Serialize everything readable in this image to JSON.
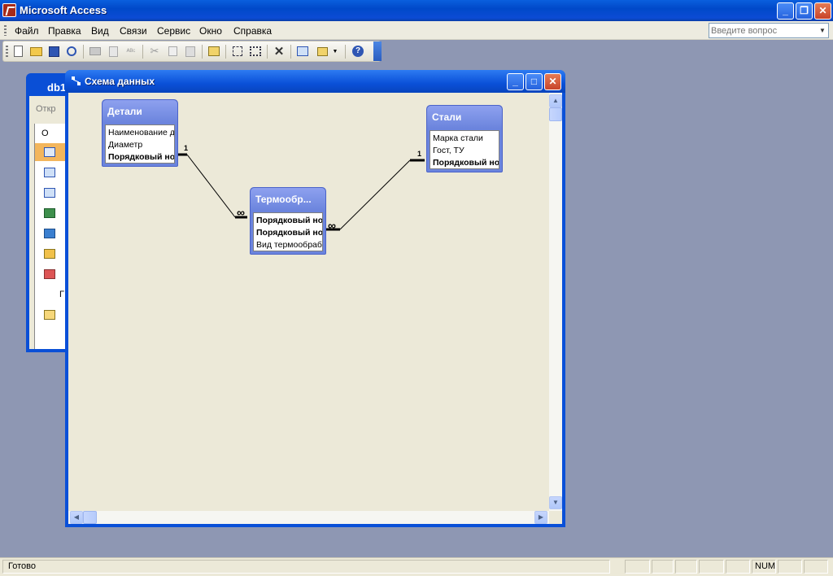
{
  "app": {
    "title": "Microsoft Access"
  },
  "menu": {
    "items": [
      "Файл",
      "Правка",
      "Вид",
      "Связи",
      "Сервис",
      "Окно",
      "Справка"
    ],
    "help_placeholder": "Введите вопрос"
  },
  "db_window": {
    "title": "db1",
    "open_label": "Откр",
    "tab_fragment": "О",
    "group_fragment": "Г"
  },
  "relationships_window": {
    "title": "Схема данных",
    "tables": {
      "details": {
        "name": "Детали",
        "fields": [
          "Наименование детали",
          "Диаметр",
          "Порядковый номер"
        ]
      },
      "heat": {
        "name": "Термообр...",
        "fields": [
          "Порядковый номер детали",
          "Порядковый номер стали",
          "Вид термообработки"
        ]
      },
      "steels": {
        "name": "Стали",
        "fields": [
          "Марка стали",
          "Гост, ТУ",
          "Порядковый номер"
        ]
      }
    },
    "relations": [
      {
        "one_label": "1",
        "many_label": "∞"
      },
      {
        "one_label": "1",
        "many_label": "∞"
      }
    ]
  },
  "status": {
    "text": "Готово",
    "num": "NUM"
  }
}
